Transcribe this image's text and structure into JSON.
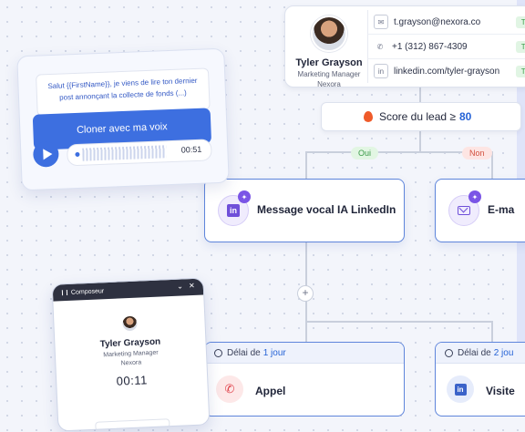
{
  "contact": {
    "name": "Tyler Grayson",
    "role": "Marketing Manager",
    "company": "Nexora",
    "email": "t.grayson@nexora.co",
    "phone": "+1 (312) 867-4309",
    "linkedin": "linkedin.com/tyler-grayson",
    "verified_label": "Tr"
  },
  "lead_score": {
    "label": "Score du lead ≥",
    "value": "80"
  },
  "branches": {
    "yes": "Oui",
    "no": "Non"
  },
  "steps": {
    "linkedin_voice": "Message vocal IA LinkedIn",
    "email": "E-ma"
  },
  "delays": [
    {
      "prefix": "Délai de",
      "value": "1 jour",
      "action": "Appel"
    },
    {
      "prefix": "Délai de",
      "value": "2 jou",
      "action": "Visite"
    }
  ],
  "voice_card": {
    "message": "Salut {{FirstName}}, je viens de lire ton dernier post annonçant la collecte de fonds (...)",
    "clone_button": "Cloner avec ma voix",
    "duration": "00:51"
  },
  "composer": {
    "title": "Composeur",
    "name": "Tyler Grayson",
    "role": "Marketing Manager",
    "company": "Nexora",
    "timer": "00:11"
  },
  "colors": {
    "accent": "#3d6fe0",
    "border_active": "#5e85db",
    "ai_purple": "#6f4fd9"
  }
}
